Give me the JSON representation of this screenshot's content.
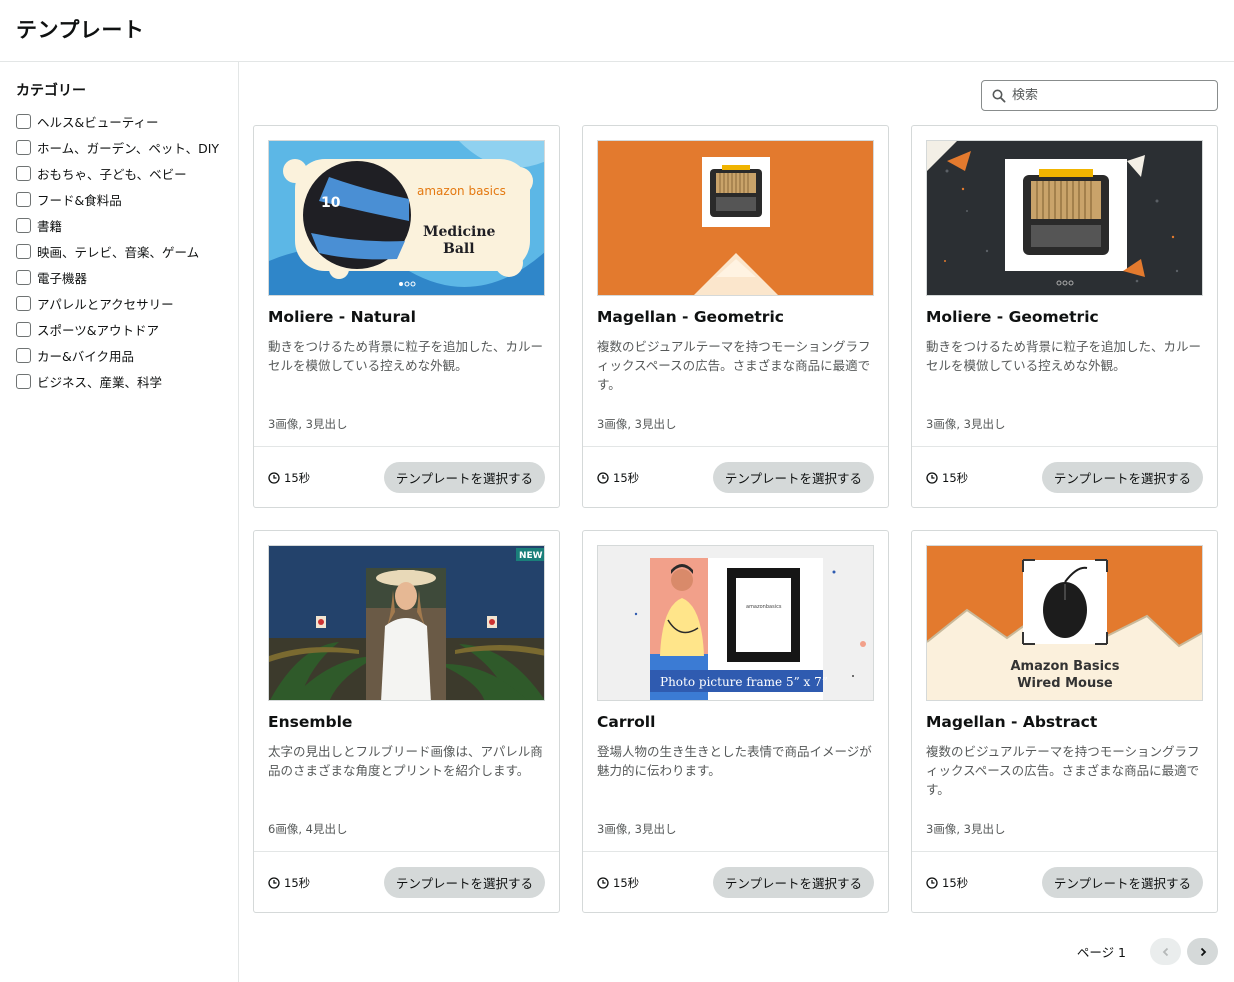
{
  "header": {
    "title": "テンプレート"
  },
  "sidebar": {
    "heading": "カテゴリー",
    "categories": [
      "ヘルス&ビューティー",
      "ホーム、ガーデン、ペット、DIY",
      "おもちゃ、子ども、ベビー",
      "フード&食料品",
      "書籍",
      "映画、テレビ、音楽、ゲーム",
      "電子機器",
      "アパレルとアクセサリー",
      "スポーツ&アウトドア",
      "カー&バイク用品",
      "ビジネス、産業、科学"
    ]
  },
  "search": {
    "placeholder": "検索",
    "icon": "search-icon"
  },
  "cards": [
    {
      "title": "Moliere - Natural",
      "desc": "動きをつけるため背景に粒子を追加した、カルーセルを模倣している控えめな外観。",
      "meta": "3画像, 3見出し",
      "duration": "15秒",
      "button": "テンプレートを選択する",
      "thumb": {
        "brand": "amazon basics",
        "product_line1": "Medicine",
        "product_line2": "Ball",
        "ball_number": "10"
      }
    },
    {
      "title": "Magellan - Geometric",
      "desc": "複数のビジュアルテーマを持つモーショングラフィックスペースの広告。さまざまな商品に最適です。",
      "meta": "3画像, 3見出し",
      "duration": "15秒",
      "button": "テンプレートを選択する"
    },
    {
      "title": "Moliere - Geometric",
      "desc": "動きをつけるため背景に粒子を追加した、カルーセルを模倣している控えめな外観。",
      "meta": "3画像, 3見出し",
      "duration": "15秒",
      "button": "テンプレートを選択する"
    },
    {
      "title": "Ensemble",
      "desc": "太字の見出しとフルブリード画像は、アパレル商品のさまざまな角度とプリントを紹介します。",
      "meta": "6画像, 4見出し",
      "duration": "15秒",
      "button": "テンプレートを選択する",
      "thumb": {
        "badge": "NEW"
      }
    },
    {
      "title": "Carroll",
      "desc": "登場人物の生き生きとした表情で商品イメージが魅力的に伝わります。",
      "meta": "3画像, 3見出し",
      "duration": "15秒",
      "button": "テンプレートを選択する",
      "thumb": {
        "caption": "Photo picture frame 5” x 7”"
      }
    },
    {
      "title": "Magellan - Abstract",
      "desc": "複数のビジュアルテーマを持つモーショングラフィックスペースの広告。さまざまな商品に最適です。",
      "meta": "3画像, 3見出し",
      "duration": "15秒",
      "button": "テンプレートを選択する",
      "thumb": {
        "product_line1": "Amazon Basics",
        "product_line2": "Wired Mouse"
      }
    }
  ],
  "pager": {
    "label": "ページ 1",
    "prev_icon": "chevron-left-icon",
    "next_icon": "chevron-right-icon"
  },
  "colors": {
    "orange": "#e37a2e",
    "navy": "#23426b",
    "sky": "#5cb7e6",
    "button_gray": "#d5d9d9"
  }
}
